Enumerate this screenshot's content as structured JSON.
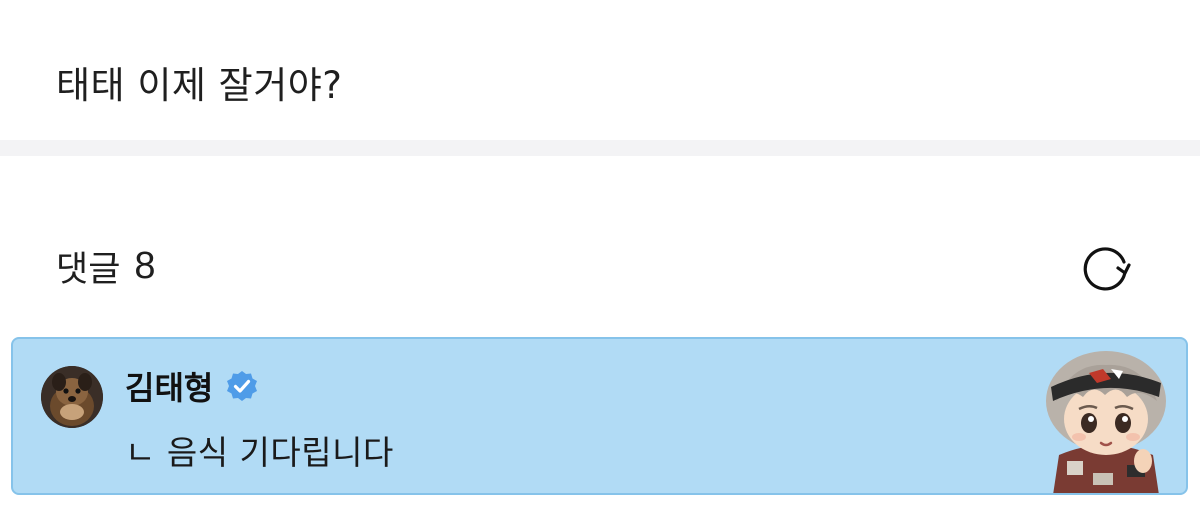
{
  "post": {
    "text": "태태 이제 잘거야?"
  },
  "comments": {
    "label": "댓글",
    "count": "8"
  },
  "header": {
    "refresh_icon": "refresh-icon"
  },
  "comment": {
    "author": "김태형",
    "verified_icon": "verified-badge-icon",
    "text": "ㄴ 음식 기다립니다",
    "highlight_color": "#b1dbf5",
    "border_color": "#86c3ea"
  }
}
